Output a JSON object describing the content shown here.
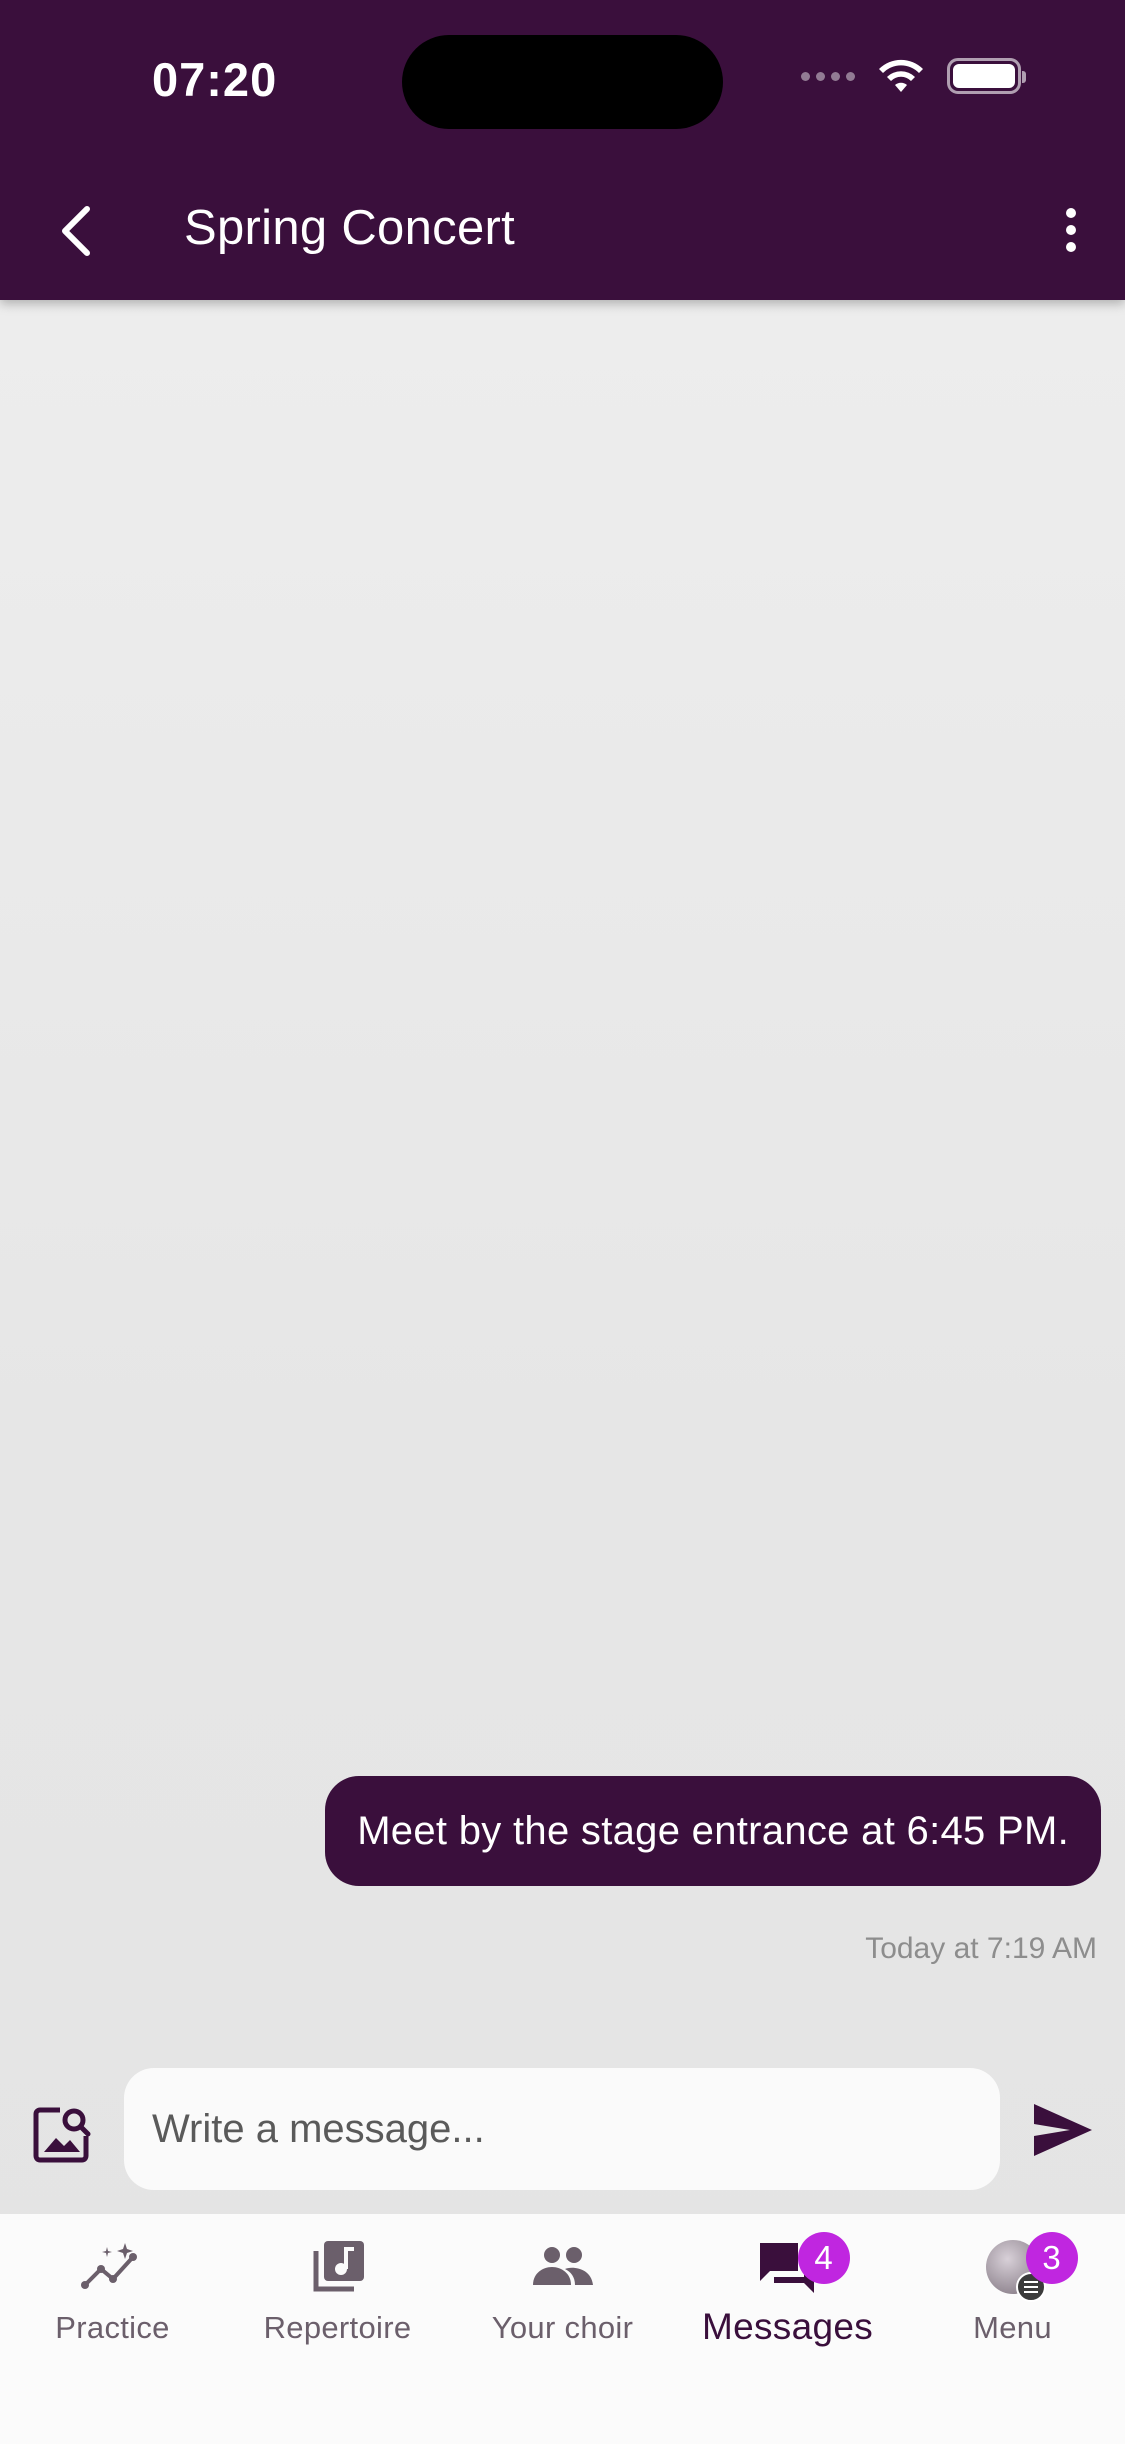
{
  "status_bar": {
    "time": "07:20"
  },
  "header": {
    "title": "Spring Concert"
  },
  "messages": [
    {
      "text": "Meet by the stage entrance at 6:45 PM.",
      "timestamp": "Today at 7:19 AM"
    }
  ],
  "composer": {
    "placeholder": "Write a message..."
  },
  "tabs": [
    {
      "label": "Practice",
      "icon": "practice-sparkle-chart-icon"
    },
    {
      "label": "Repertoire",
      "icon": "music-library-icon"
    },
    {
      "label": "Your choir",
      "icon": "people-icon"
    },
    {
      "label": "Messages",
      "icon": "chat-bubbles-icon",
      "badge": "4",
      "active": true
    },
    {
      "label": "Menu",
      "icon": "avatar",
      "badge": "3"
    }
  ],
  "colors": {
    "brand": "#3a0f3c",
    "badge": "#c026e0"
  }
}
